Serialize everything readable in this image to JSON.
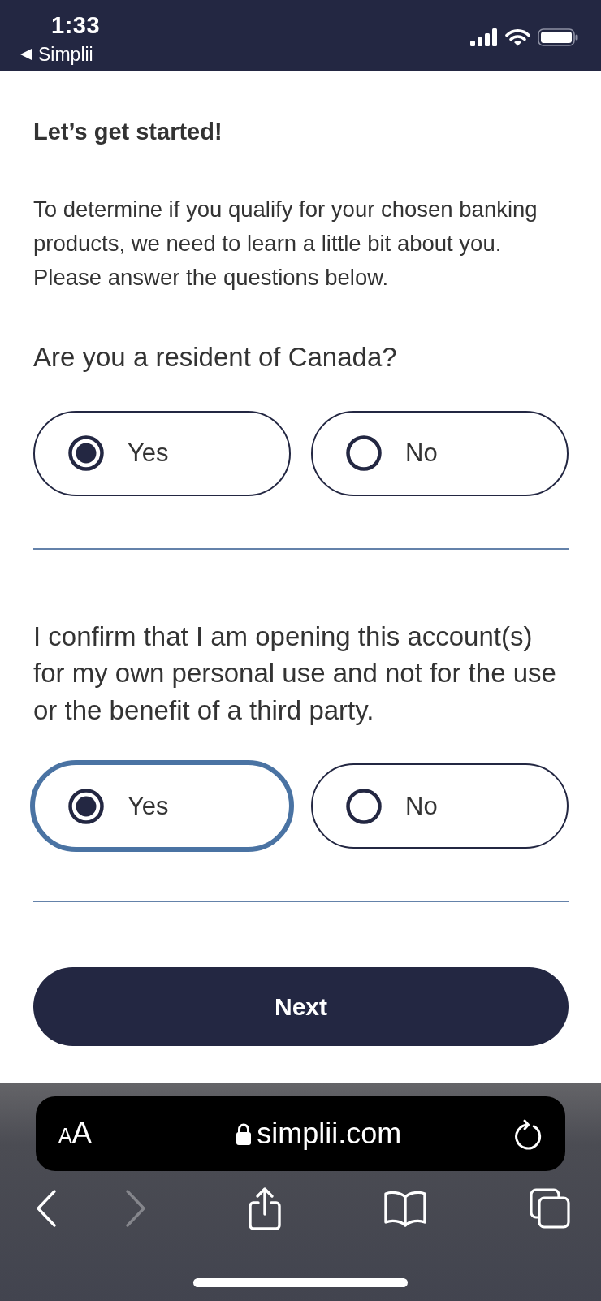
{
  "status_bar": {
    "time": "1:33",
    "back_label": "Simplii"
  },
  "page": {
    "title": "Let’s get started!",
    "intro": "To determine if you qualify for your chosen banking products, we need to learn a little bit about you. Please answer the questions below."
  },
  "questions": [
    {
      "text": "Are you a resident of Canada?",
      "options": [
        {
          "label": "Yes",
          "selected": true,
          "focused": false
        },
        {
          "label": "No",
          "selected": false,
          "focused": false
        }
      ]
    },
    {
      "text": "I confirm that I am opening this account(s) for my own personal use and not for the use or the benefit of a third party.",
      "options": [
        {
          "label": "Yes",
          "selected": true,
          "focused": true
        },
        {
          "label": "No",
          "selected": false,
          "focused": false
        }
      ]
    }
  ],
  "next_button": {
    "label": "Next"
  },
  "browser": {
    "text_size_label": "AA",
    "url": "simplii.com",
    "toolbar": [
      {
        "kind": "back",
        "disabled": false
      },
      {
        "kind": "forward",
        "disabled": true
      },
      {
        "kind": "share",
        "disabled": false
      },
      {
        "kind": "bookmarks",
        "disabled": false
      },
      {
        "kind": "tabs",
        "disabled": false
      }
    ]
  }
}
